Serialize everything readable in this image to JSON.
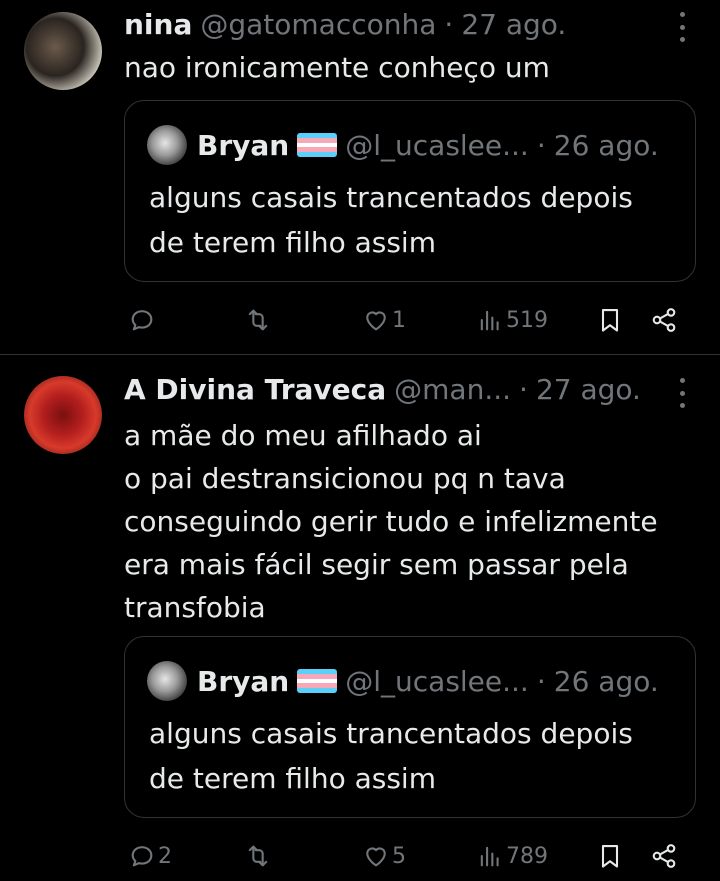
{
  "colors": {
    "background": "#000000",
    "text": "#e7e9ea",
    "muted": "#71767b",
    "border": "#2f3336",
    "flag_blue": "#5bcefa",
    "flag_pink": "#f5a9b8",
    "flag_white": "#ffffff"
  },
  "tweets": [
    {
      "author_name": "nina",
      "handle": "@gatomacconha",
      "separator": "·",
      "date": "27 ago.",
      "text": "nao ironicamente conheço um",
      "quote": {
        "author_name": "Bryan",
        "handle": "@l_ucaslee...",
        "separator": "·",
        "date": "26 ago.",
        "text": "alguns casais trancentados depois\nde terem filho assim"
      },
      "actions": {
        "reply_count": "",
        "retweet_count": "",
        "like_count": "1",
        "views_count": "519"
      }
    },
    {
      "author_name": "A Divina Traveca",
      "handle": "@man...",
      "separator": "·",
      "date": "27 ago.",
      "text": "a mãe do meu afilhado ai\no pai destransicionou pq n tava\nconseguindo gerir tudo e infelizmente\nera mais fácil segir sem passar pela\ntransfobia",
      "quote": {
        "author_name": "Bryan",
        "handle": "@l_ucaslee...",
        "separator": "·",
        "date": "26 ago.",
        "text": "alguns casais trancentados depois\nde terem filho assim"
      },
      "actions": {
        "reply_count": "2",
        "retweet_count": "",
        "like_count": "5",
        "views_count": "789"
      }
    }
  ],
  "icons": {
    "reply": "reply-icon",
    "retweet": "retweet-icon",
    "like": "heart-icon",
    "views": "views-chart-icon",
    "bookmark": "bookmark-icon",
    "share": "share-icon",
    "more": "more-vertical-icon"
  }
}
